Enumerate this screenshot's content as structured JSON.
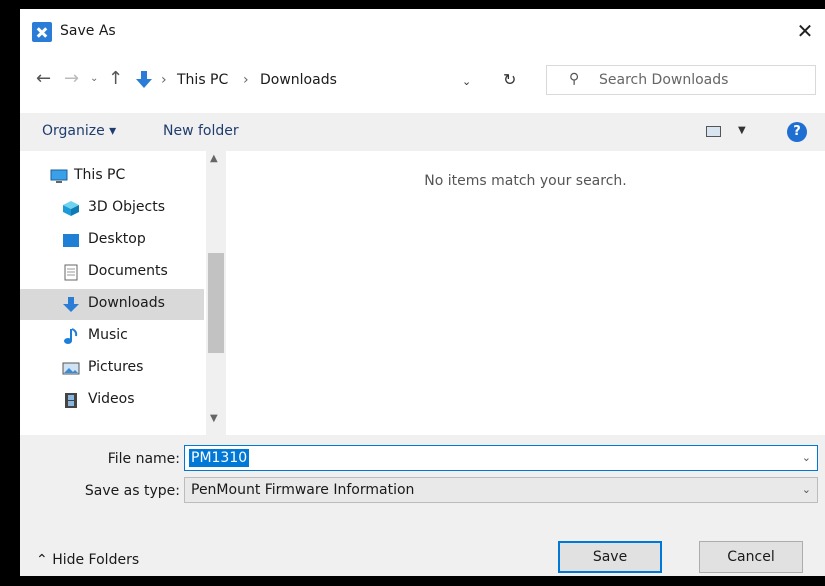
{
  "window": {
    "title": "Save As"
  },
  "nav": {
    "back": "←",
    "forward": "→",
    "recent": "⌄",
    "up": "↑",
    "address": {
      "sep": "›",
      "this_pc": "This PC",
      "downloads": "Downloads"
    },
    "refresh": "↻",
    "search_placeholder": "Search Downloads"
  },
  "command_bar": {
    "organize": "Organize ▾",
    "new_folder": "New folder",
    "help": "?"
  },
  "sidebar": {
    "items": [
      {
        "label": "This PC",
        "icon": "monitor-icon"
      },
      {
        "label": "3D Objects",
        "icon": "cube-icon"
      },
      {
        "label": "Desktop",
        "icon": "desktop-icon"
      },
      {
        "label": "Documents",
        "icon": "document-icon"
      },
      {
        "label": "Downloads",
        "icon": "download-arrow-icon",
        "selected": true
      },
      {
        "label": "Music",
        "icon": "music-note-icon"
      },
      {
        "label": "Pictures",
        "icon": "picture-icon"
      },
      {
        "label": "Videos",
        "icon": "film-icon"
      }
    ]
  },
  "content": {
    "empty_message": "No items match your search."
  },
  "form": {
    "file_name_label": "File name:",
    "file_name_value": "PM1310",
    "save_type_label": "Save as type:",
    "save_type_value": "PenMount Firmware Information"
  },
  "footer": {
    "hide_folders": "Hide Folders",
    "save": "Save",
    "cancel": "Cancel"
  },
  "colors": {
    "accent": "#0078d7",
    "selection": "#d9d9d9",
    "link": "#1f3d6e"
  }
}
